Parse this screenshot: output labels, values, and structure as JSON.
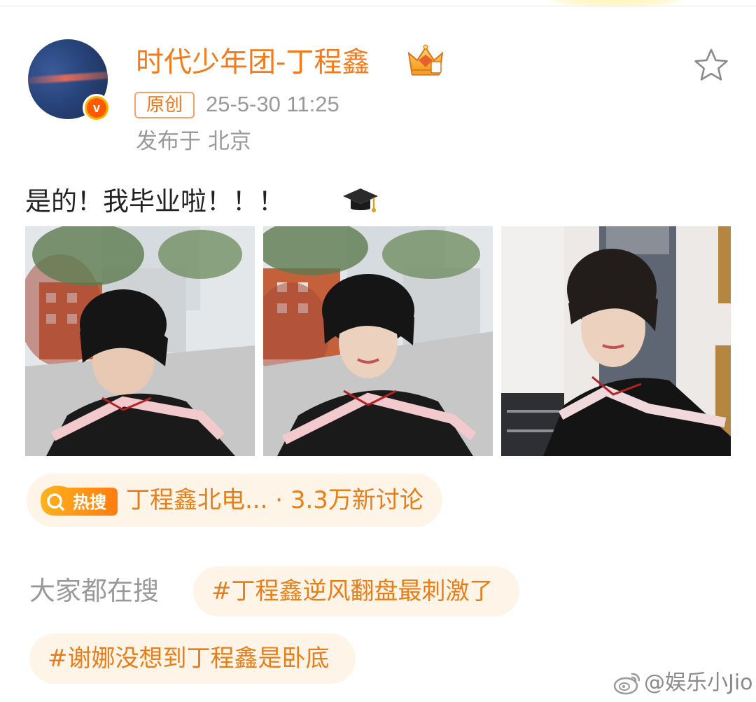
{
  "post": {
    "username": "时代少年团-丁程鑫",
    "original_badge": "原创",
    "timestamp": "25-5-30 11:25",
    "location": "发布于 北京",
    "text": "是的！我毕业啦！！！"
  },
  "icons": {
    "crown": "crown-badge-icon",
    "verified": "verified-v-icon",
    "favorite": "star-icon",
    "graduation": "graduation-cap-icon",
    "hot_search": "search-icon",
    "watermark": "weibo-logo-icon"
  },
  "hot_search": {
    "badge_label": "热搜",
    "text": "丁程鑫北电... · 3.3万新讨论"
  },
  "trending": {
    "label": "大家都在搜",
    "chips": [
      "#丁程鑫逆风翻盘最刺激了",
      "#谢娜没想到丁程鑫是卧底"
    ]
  },
  "watermark": "@娱乐小Jio",
  "colors": {
    "accent": "#f37b1d",
    "chip_bg": "#fff4e8",
    "meta_text": "#999999"
  }
}
